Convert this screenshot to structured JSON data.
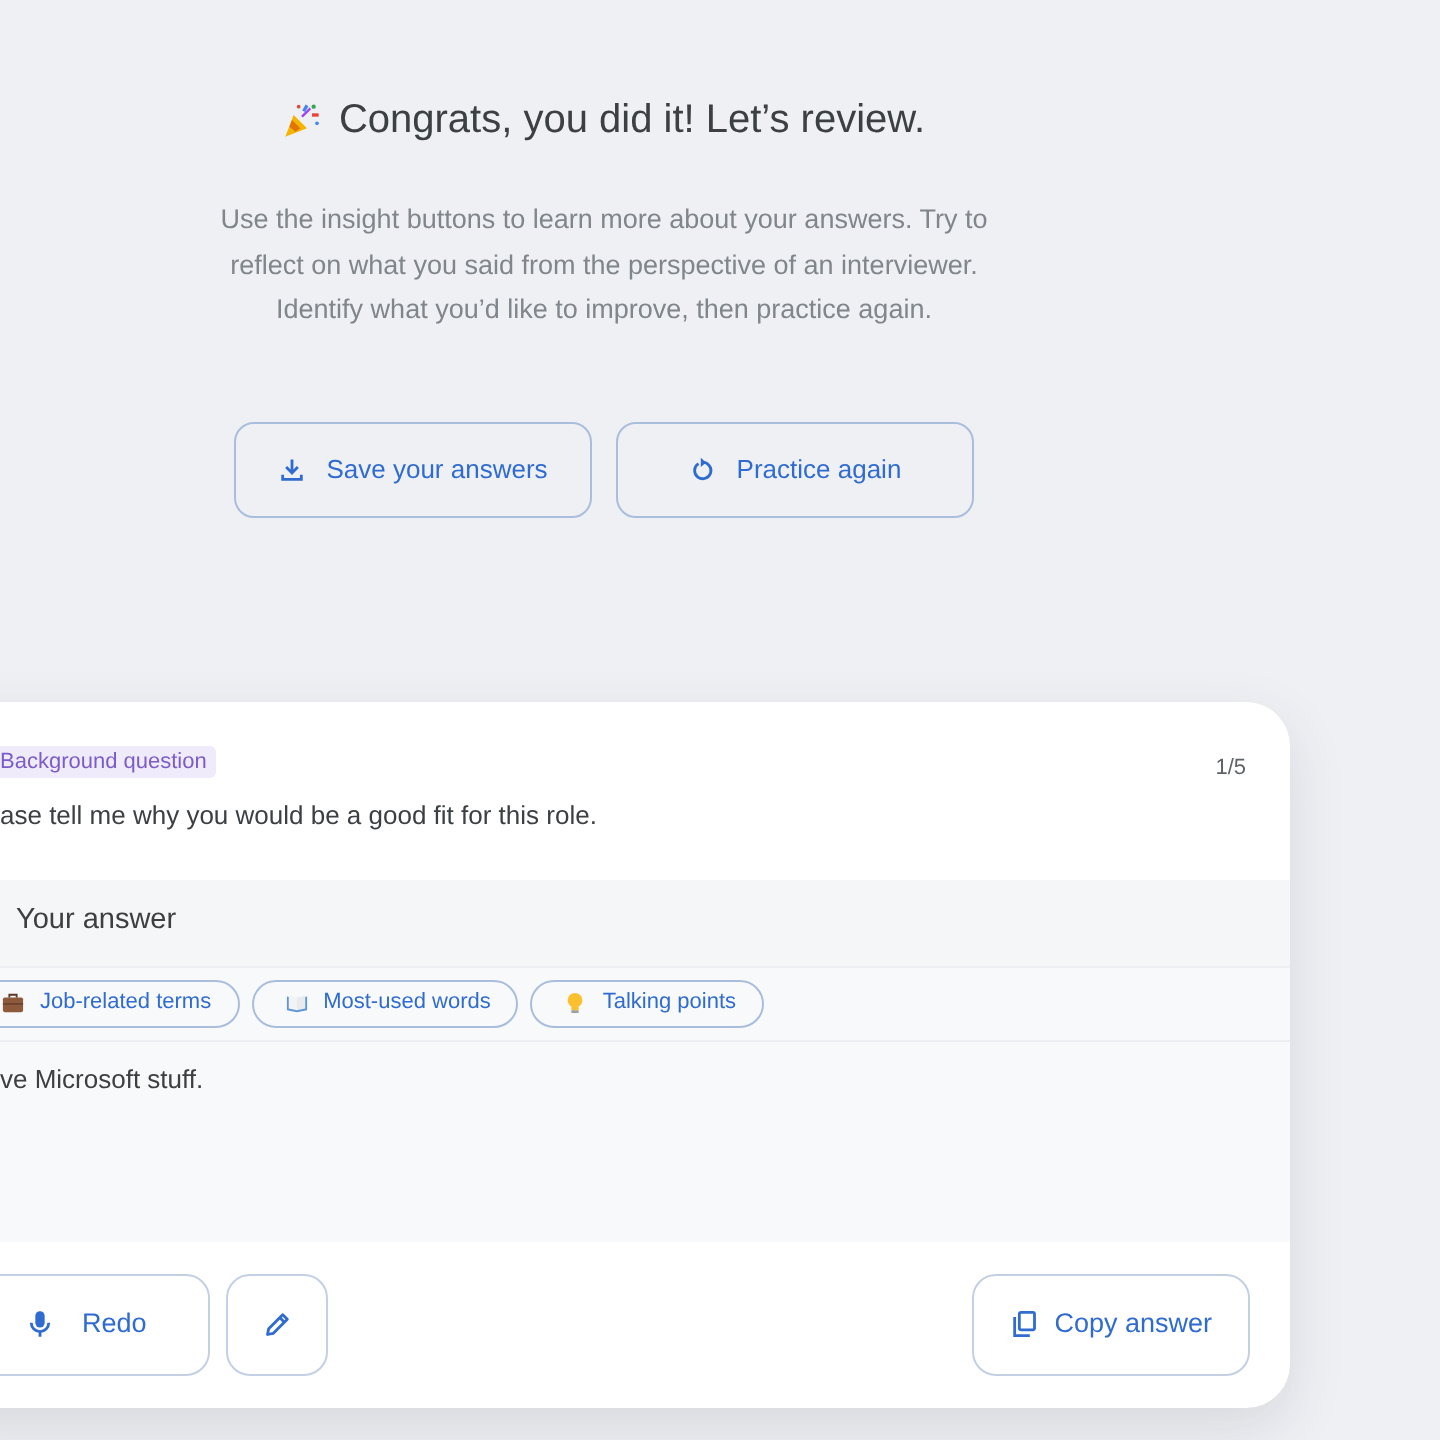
{
  "header": {
    "title": "Congrats, you did it! Let’s review.",
    "intro": "Use the insight buttons to learn more about your answers. Try to reflect on what you said from the perspective of an interviewer. Identify what you’d like to improve, then practice again.",
    "actions": [
      {
        "kind": "download",
        "label": "Save your answers"
      },
      {
        "kind": "restart",
        "label": "Practice again"
      }
    ]
  },
  "question_card": {
    "category": "Background question",
    "counter": "1/5",
    "question": "ase tell me why you would be a good fit for this role.",
    "answer_heading": "Your answer",
    "insight_chips": [
      {
        "kind": "briefcase",
        "label": "Job-related terms"
      },
      {
        "kind": "book",
        "label": "Most-used words"
      },
      {
        "kind": "bulb",
        "label": "Talking points"
      }
    ],
    "answer": "ve Microsoft stuff.",
    "footer_actions": [
      {
        "kind": "record",
        "label": "Redo"
      },
      {
        "kind": "edit"
      },
      {
        "kind": "copy",
        "label": "Copy answer"
      }
    ]
  }
}
